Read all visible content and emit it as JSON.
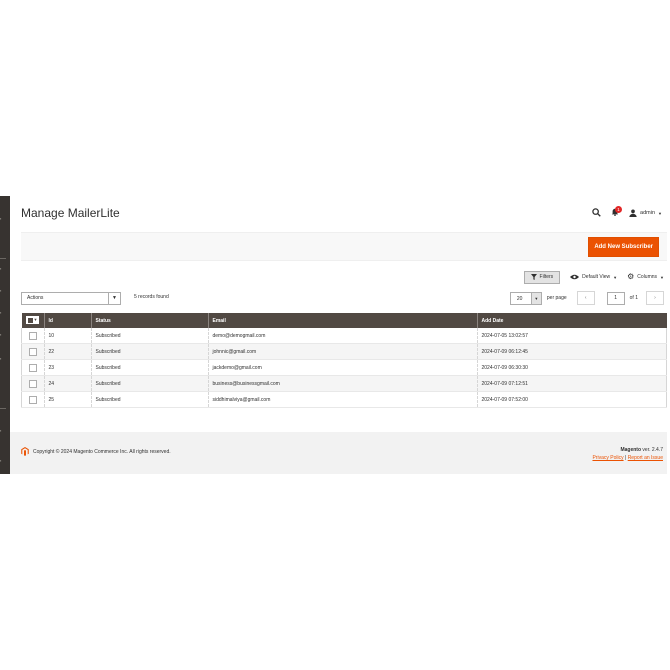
{
  "page": {
    "title": "Manage MailerLite"
  },
  "header": {
    "notification_count": "1",
    "user": "admin"
  },
  "toolbar": {
    "add_button": "Add New Subscriber"
  },
  "controls": {
    "filters": "Filters",
    "view": "Default View",
    "columns": "Columns",
    "actions": "Actions",
    "records": "5 records found",
    "per_page_value": "20",
    "per_page_label": "per page",
    "page_current": "1",
    "page_total": "of 1"
  },
  "grid": {
    "columns": [
      "Id",
      "Status",
      "Email",
      "Add Date"
    ],
    "rows": [
      {
        "id": "10",
        "status": "Subscribed",
        "email": "demo@demogmail.com",
        "date": "2024-07-05 13:02:57"
      },
      {
        "id": "22",
        "status": "Subscribed",
        "email": "johnnic@gmail.com",
        "date": "2024-07-09 06:12:45"
      },
      {
        "id": "23",
        "status": "Subscribed",
        "email": "jackdemo@gmail.com",
        "date": "2024-07-09 06:30:30"
      },
      {
        "id": "24",
        "status": "Subscribed",
        "email": "business@businessgmail.com",
        "date": "2024-07-09 07:12:51"
      },
      {
        "id": "25",
        "status": "Subscribed",
        "email": "siddhimalviya@gmail.com",
        "date": "2024-07-09 07:52:00"
      }
    ]
  },
  "footer": {
    "copyright": "Copyright © 2024 Magento Commerce Inc. All rights reserved.",
    "brand": "Magento",
    "version": " ver. 2.4.7",
    "privacy": "Privacy Policy",
    "separator": "|",
    "report": "Report an Issue"
  },
  "colors": {
    "accent": "#eb5202",
    "grid_header": "#514943",
    "sidebar": "#373330"
  }
}
